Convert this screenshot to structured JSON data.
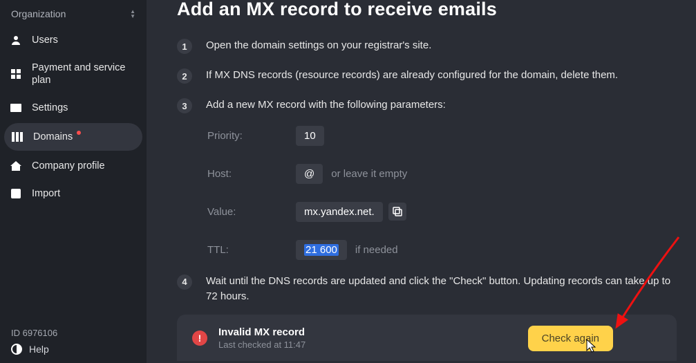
{
  "sidebar": {
    "org_label": "Organization",
    "items": [
      {
        "label": "Users"
      },
      {
        "label": "Payment and service plan"
      },
      {
        "label": "Settings"
      },
      {
        "label": "Domains"
      },
      {
        "label": "Company profile"
      },
      {
        "label": "Import"
      }
    ],
    "id_line": "ID 6976106",
    "help": "Help"
  },
  "main": {
    "title": "Add an MX record to receive emails",
    "steps": [
      {
        "num": "1",
        "text": "Open the domain settings on your registrar's site."
      },
      {
        "num": "2",
        "text": "If MX DNS records (resource records) are already configured for the domain, delete them."
      },
      {
        "num": "3",
        "text": "Add a new MX record with the following parameters:"
      },
      {
        "num": "4",
        "text": "Wait until the DNS records are updated and click the \"Check\" button. Updating records can take up to 72 hours."
      }
    ],
    "params": {
      "priority_label": "Priority:",
      "priority_value": "10",
      "host_label": "Host:",
      "host_value": "@",
      "host_note": "or leave it empty",
      "value_label": "Value:",
      "value_value": "mx.yandex.net.",
      "ttl_label": "TTL:",
      "ttl_value": "21 600",
      "ttl_note": "if needed"
    },
    "status": {
      "title": "Invalid MX record",
      "subtitle": "Last checked at 11:47",
      "button": "Check again"
    }
  }
}
